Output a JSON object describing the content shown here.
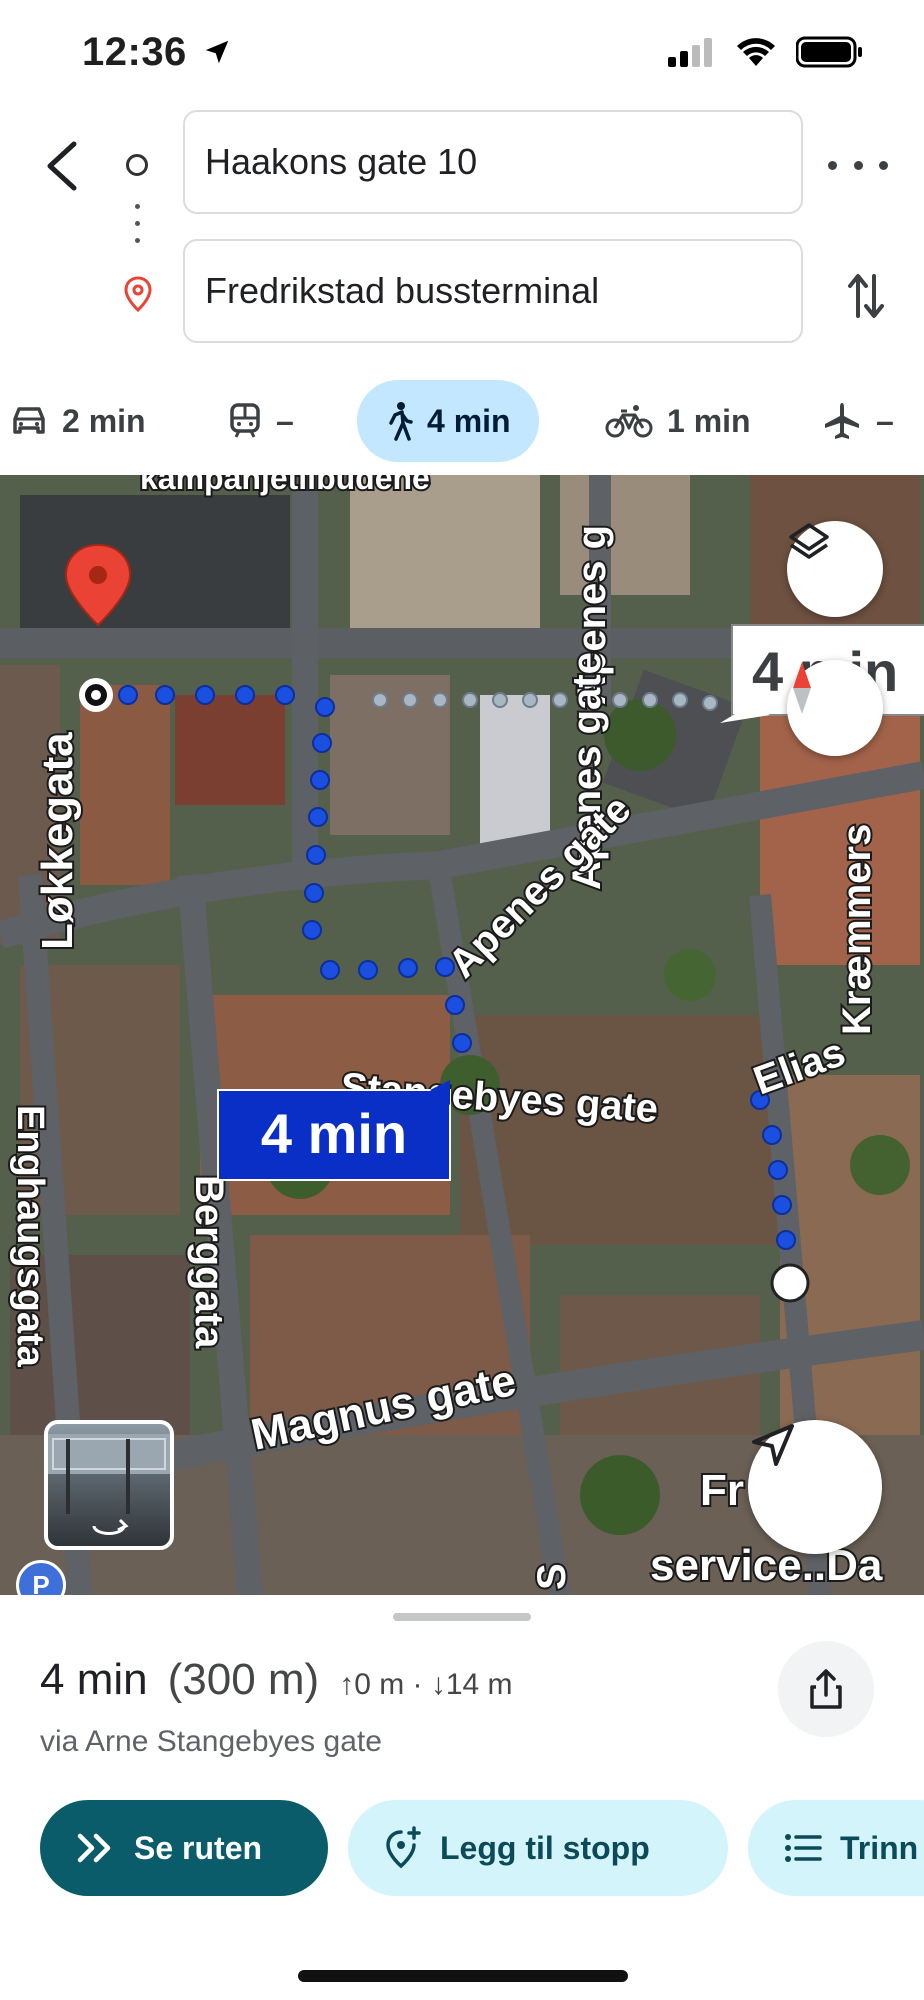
{
  "status_bar": {
    "time": "12:36"
  },
  "directions": {
    "origin": "Haakons gate 10",
    "destination": "Fredrikstad bussterminal"
  },
  "modes": [
    {
      "name": "car",
      "label": "2 min"
    },
    {
      "name": "transit",
      "label": "–"
    },
    {
      "name": "walk",
      "label": "4 min",
      "active": true
    },
    {
      "name": "bike",
      "label": "1 min"
    },
    {
      "name": "flight",
      "label": "–"
    }
  ],
  "map": {
    "route_badge": "4 min",
    "alt_route_badge": "4 min",
    "street_labels": {
      "lokkegata": "Løkkegata",
      "apenes_gate_1": "Apenes g",
      "apenes_gate_2": "Apenes gate",
      "apenes_gate_3": "Apenes gate",
      "stangebyes": "Stangebyes gate",
      "elias": "Elias",
      "kraemmer": "Kræmmers",
      "berggata": "Berggata",
      "enghaugs": "Enghaugsgata",
      "magnus": "Magnus gate",
      "kampanje": "kampanjetilbudene",
      "fr_sta": "Fr      sta",
      "service": "service..Da",
      "s_letter": "S"
    },
    "parking_label": "P"
  },
  "sheet": {
    "duration": "4 min",
    "distance": "(300 m)",
    "elevation": "↑0 m · ↓14 m",
    "via": "via Arne Stangebyes gate",
    "buttons": {
      "start": "Se ruten",
      "add_stop": "Legg til stopp",
      "steps": "Trinn"
    }
  },
  "colors": {
    "route_blue": "#1a4fe0",
    "active_mode_bg": "#c2e7ff",
    "primary_button": "#0b5c6b",
    "secondary_button": "#d3f4fb",
    "pin_red": "#ea4335"
  }
}
